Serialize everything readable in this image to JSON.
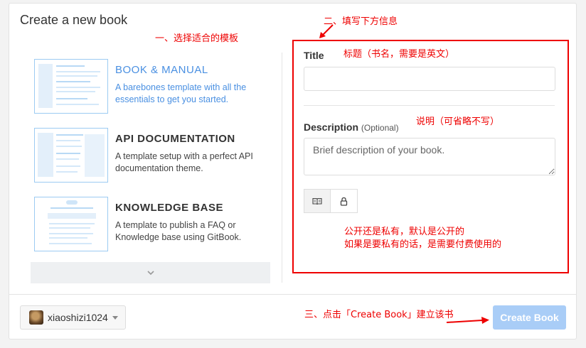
{
  "page": {
    "title": "Create a new book"
  },
  "templates": [
    {
      "name": "BOOK & MANUAL",
      "desc": "A barebones template with all the essentials to get you started."
    },
    {
      "name": "API DOCUMENTATION",
      "desc": "A template setup with a perfect API documentation theme."
    },
    {
      "name": "KNOWLEDGE BASE",
      "desc": "A template to publish a FAQ or Knowledge base using GitBook."
    }
  ],
  "form": {
    "title_label": "Title",
    "title_value": "",
    "description_label": "Description",
    "description_optional": "(Optional)",
    "description_placeholder": "Brief description of your book."
  },
  "footer": {
    "username": "xiaoshizi1024",
    "create_label": "Create Book"
  },
  "icons": {
    "public": "book-open-icon",
    "private": "lock-icon",
    "more": "chevron-down-icon"
  },
  "annotations": {
    "step1": "一、选择适合的模板",
    "step2": "二、填写下方信息",
    "title_note": "标题（书名，需要是英文）",
    "desc_note": "说明（可省略不写）",
    "visibility_note_1": "公开还是私有，默认是公开的",
    "visibility_note_2": "如果是要私有的话，是需要付费使用的",
    "step3": "三、点击「Create Book」建立该书"
  },
  "colors": {
    "accent": "#4a90e2",
    "annotation": "#ee0000",
    "create_button": "#a9cdf7"
  }
}
